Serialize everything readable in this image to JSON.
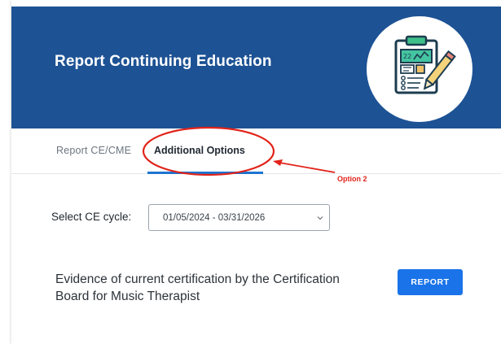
{
  "header": {
    "title": "Report Continuing Education",
    "background_color": "#1d5294",
    "logo_icon": "clipboard-pencil-icon"
  },
  "tabs": [
    {
      "label": "Report CE/CME",
      "active": false
    },
    {
      "label": "Additional Options",
      "active": true
    }
  ],
  "annotation": {
    "label": "Option 2",
    "color": "#e2231a"
  },
  "cycle": {
    "label": "Select CE cycle:",
    "selected": "01/05/2024 - 03/31/2026"
  },
  "evidence": {
    "text": "Evidence of current certification by the Certification Board for Music Therapist"
  },
  "report_button": {
    "label": "REPORT",
    "color": "#1a73e8"
  }
}
